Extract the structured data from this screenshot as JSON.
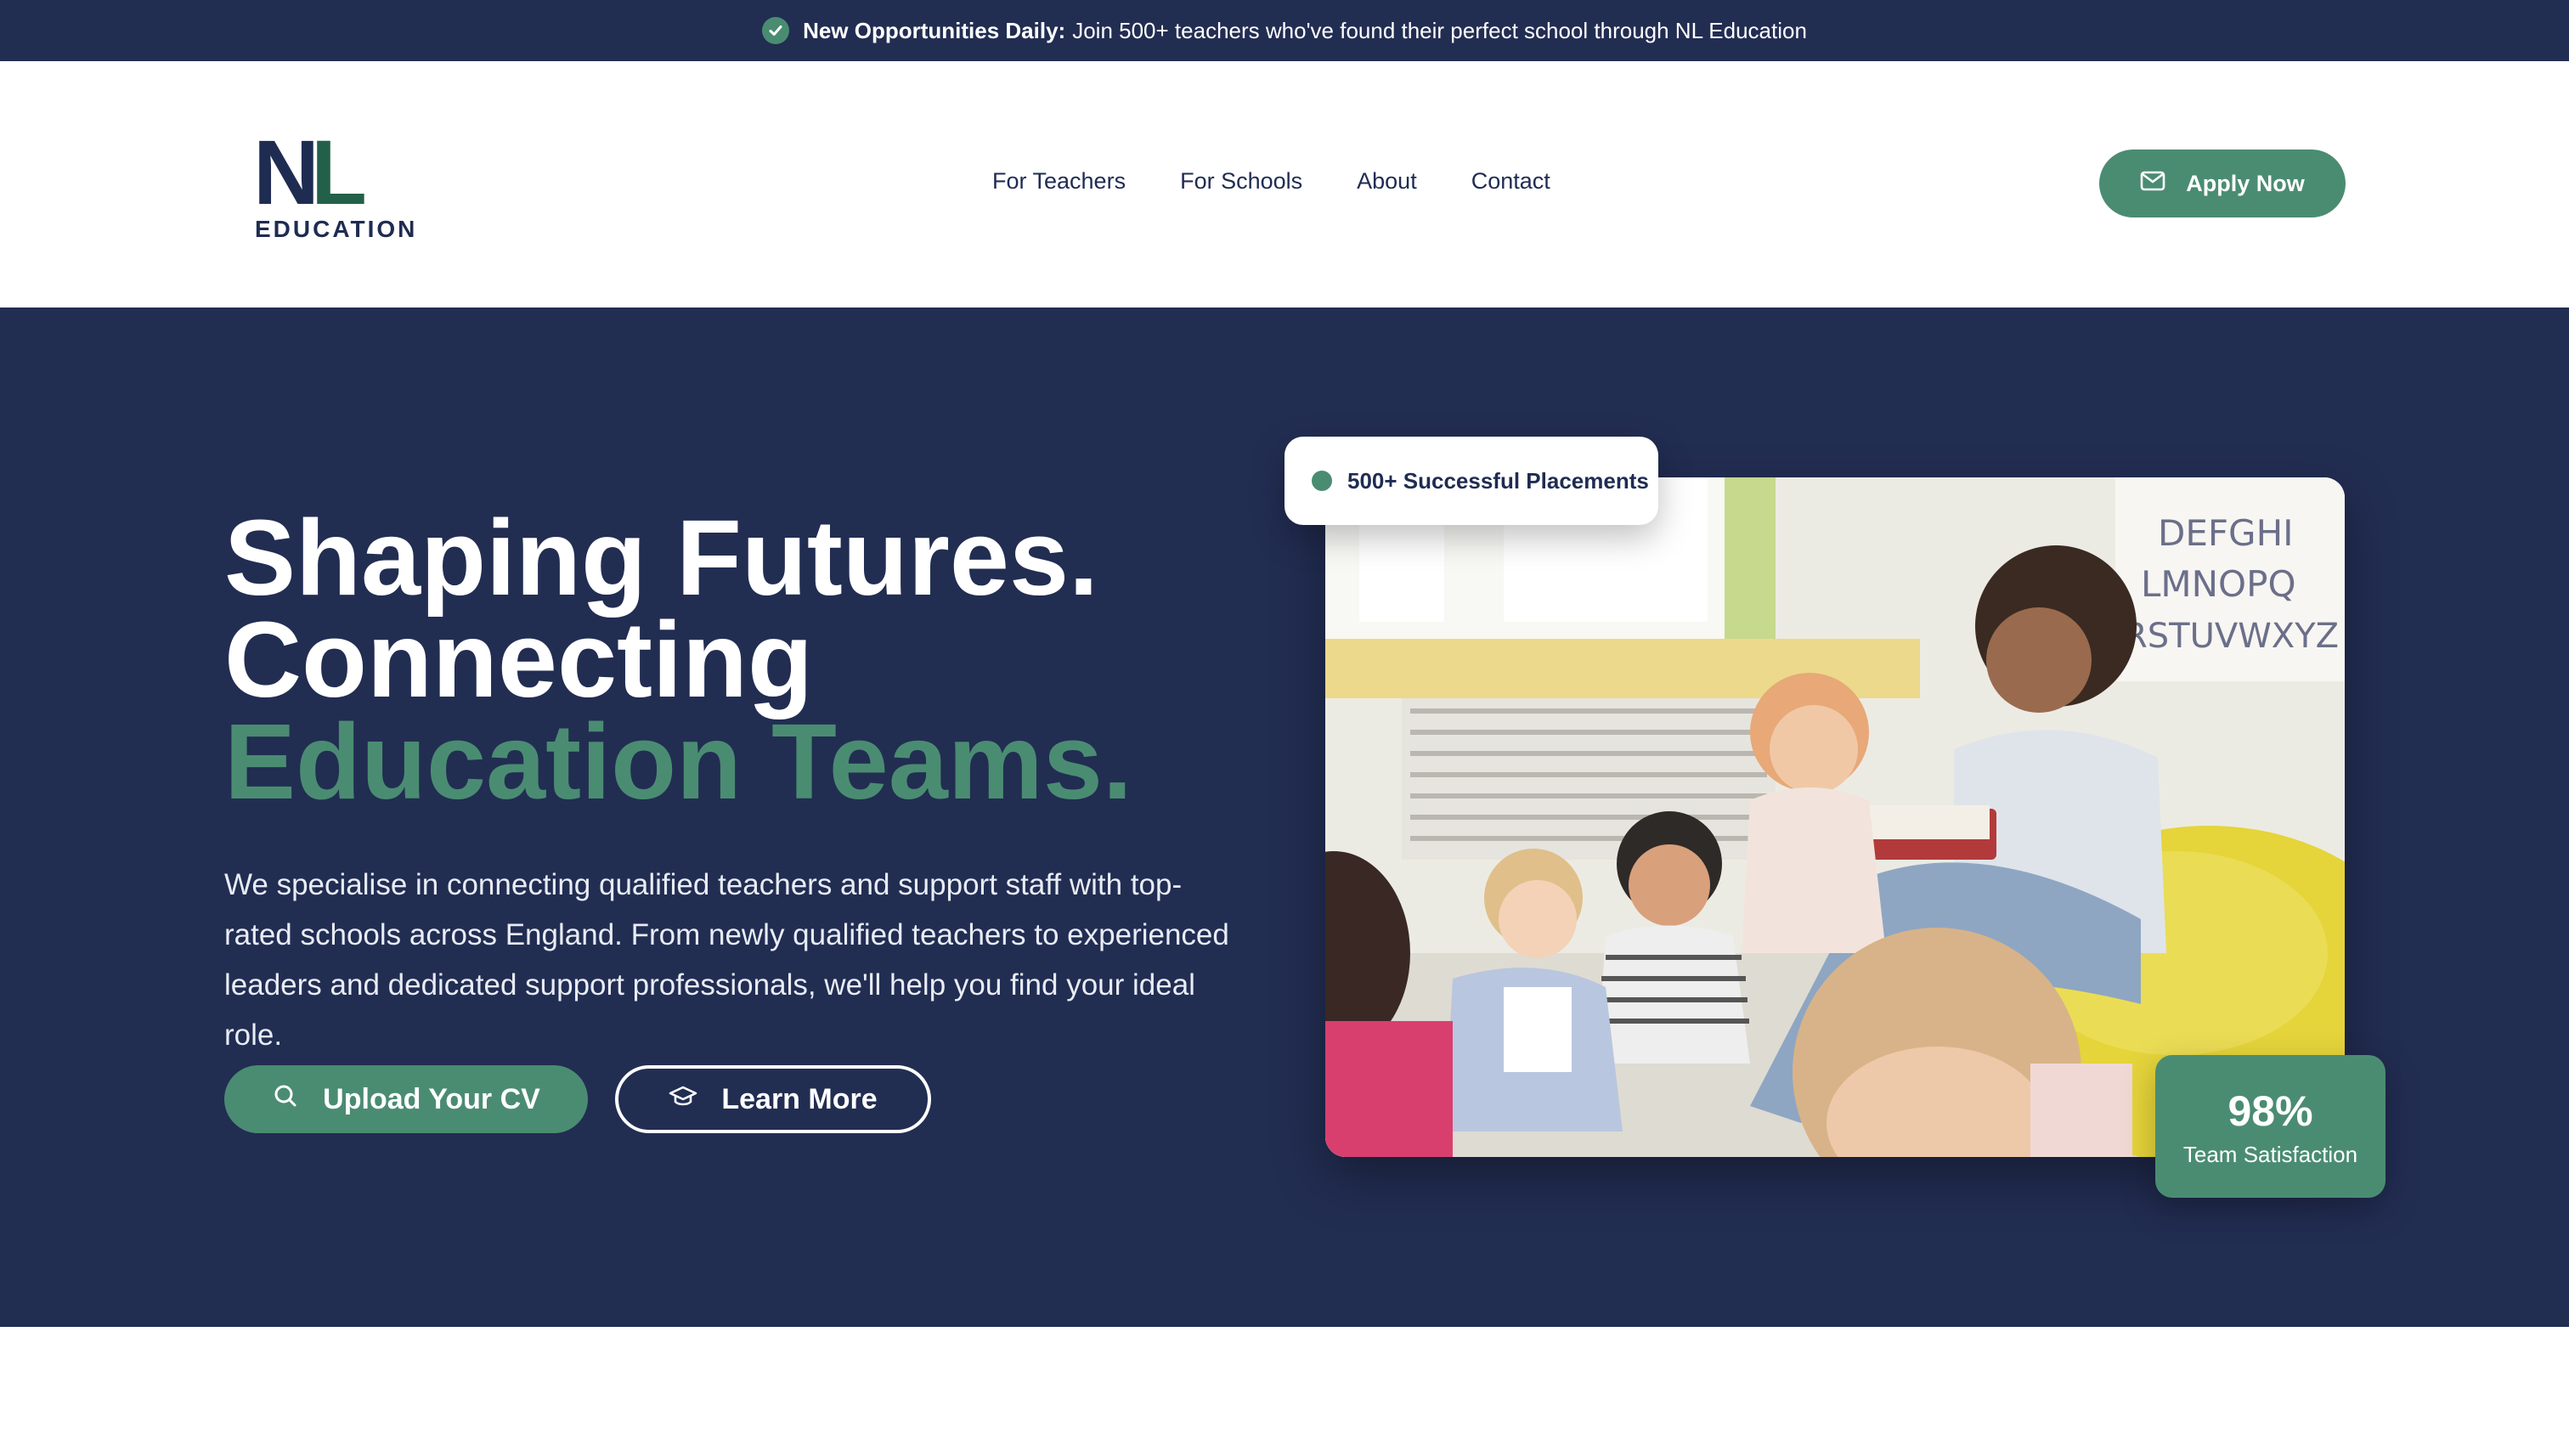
{
  "colors": {
    "navy": "#222d52",
    "green": "#4a8c72",
    "white": "#ffffff"
  },
  "announcement": {
    "icon": "check-circle-icon",
    "strong": "New Opportunities Daily:",
    "text": "Join 500+ teachers who've found their perfect school through NL Education"
  },
  "logo": {
    "mark": "NL",
    "word": "EDUCATION"
  },
  "nav": {
    "items": [
      "For Teachers",
      "For Schools",
      "About",
      "Contact"
    ]
  },
  "header": {
    "cta_label": "Apply Now",
    "cta_icon": "mail-icon"
  },
  "hero": {
    "line1": "Shaping Futures.",
    "line2": "Connecting",
    "line3": "Education Teams.",
    "body": "We specialise in connecting qualified teachers and support staff with top-rated schools across England. From newly qualified teachers to experienced leaders and dedicated support professionals, we'll help you find your ideal role.",
    "primary_label": "Upload Your CV",
    "primary_icon": "search-icon",
    "secondary_label": "Learn More",
    "secondary_icon": "graduation-cap-icon"
  },
  "badges": {
    "placements": "500+ Successful Placements",
    "stat_value": "98%",
    "stat_label": "Team Satisfaction"
  },
  "photo": {
    "alphabet_line1": "DEFGHI",
    "alphabet_line2": "LMNOPQ",
    "alphabet_line3": "RSTUVWXYZ"
  }
}
